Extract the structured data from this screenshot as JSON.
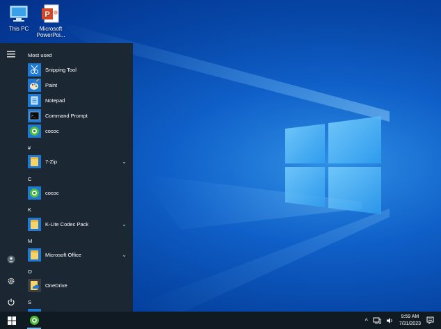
{
  "desktop": {
    "icons": [
      {
        "label_line1": "This PC",
        "label_line2": "",
        "icon": "this-pc-icon"
      },
      {
        "label_line1": "Microsoft",
        "label_line2": "PowerPoi...",
        "icon": "powerpoint-icon"
      }
    ]
  },
  "start_menu": {
    "most_used_header": "Most used",
    "most_used": [
      {
        "label": "Snipping Tool",
        "icon": "snipping-tool-icon"
      },
      {
        "label": "Paint",
        "icon": "paint-icon"
      },
      {
        "label": "Notepad",
        "icon": "notepad-icon"
      },
      {
        "label": "Command Prompt",
        "icon": "command-prompt-icon"
      },
      {
        "label": "cococ",
        "icon": "cococ-icon"
      }
    ],
    "groups": [
      {
        "letter": "#",
        "items": [
          {
            "label": "7-Zip",
            "icon": "folder-icon",
            "expandable": true
          }
        ]
      },
      {
        "letter": "C",
        "items": [
          {
            "label": "cococ",
            "icon": "cococ-icon",
            "expandable": false
          }
        ]
      },
      {
        "letter": "K",
        "items": [
          {
            "label": "K-Lite Codec Pack",
            "icon": "folder-icon",
            "expandable": true
          }
        ]
      },
      {
        "letter": "M",
        "items": [
          {
            "label": "Microsoft Office",
            "icon": "folder-icon",
            "expandable": true
          }
        ]
      },
      {
        "letter": "O",
        "items": [
          {
            "label": "OneDrive",
            "icon": "onedrive-icon",
            "expandable": false
          }
        ]
      },
      {
        "letter": "S",
        "items": []
      }
    ],
    "chevron": "⌄"
  },
  "taskbar": {
    "time": "9:59 AM",
    "date": "7/31/2023",
    "tray_arrow": "^"
  },
  "colors": {
    "accent": "#0a63c9",
    "start_bg": "#1c262e",
    "taskbar_bg": "#101a22"
  }
}
